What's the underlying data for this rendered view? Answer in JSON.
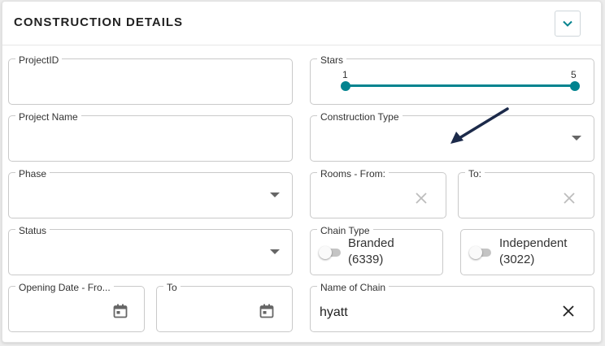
{
  "header": {
    "title": "CONSTRUCTION DETAILS",
    "collapse_icon": "chevron-down-icon",
    "accent_color": "#00838f"
  },
  "fields": {
    "project_id": {
      "label": "ProjectID",
      "value": ""
    },
    "project_name": {
      "label": "Project Name",
      "value": ""
    },
    "phase": {
      "label": "Phase",
      "value": ""
    },
    "status": {
      "label": "Status",
      "value": ""
    },
    "opening_date_from": {
      "label": "Opening Date - Fro...",
      "value": ""
    },
    "opening_date_to": {
      "label": "To",
      "value": ""
    },
    "stars": {
      "label": "Stars",
      "min_label": "1",
      "max_label": "5",
      "range": [
        1,
        5
      ]
    },
    "construction_type": {
      "label": "Construction Type",
      "value": ""
    },
    "rooms_from": {
      "label": "Rooms - From:",
      "value": ""
    },
    "rooms_to": {
      "label": "To:",
      "value": ""
    },
    "chain_type": {
      "label": "Chain Type",
      "branded": {
        "line1": "Branded",
        "line2": "(6339)",
        "checked": false
      },
      "independent": {
        "line1": "Independent",
        "line2": "(3022)",
        "checked": false
      }
    },
    "name_of_chain": {
      "label": "Name of Chain",
      "value": "hyatt"
    }
  },
  "annotation": {
    "arrow_color": "#1c2a4a"
  }
}
